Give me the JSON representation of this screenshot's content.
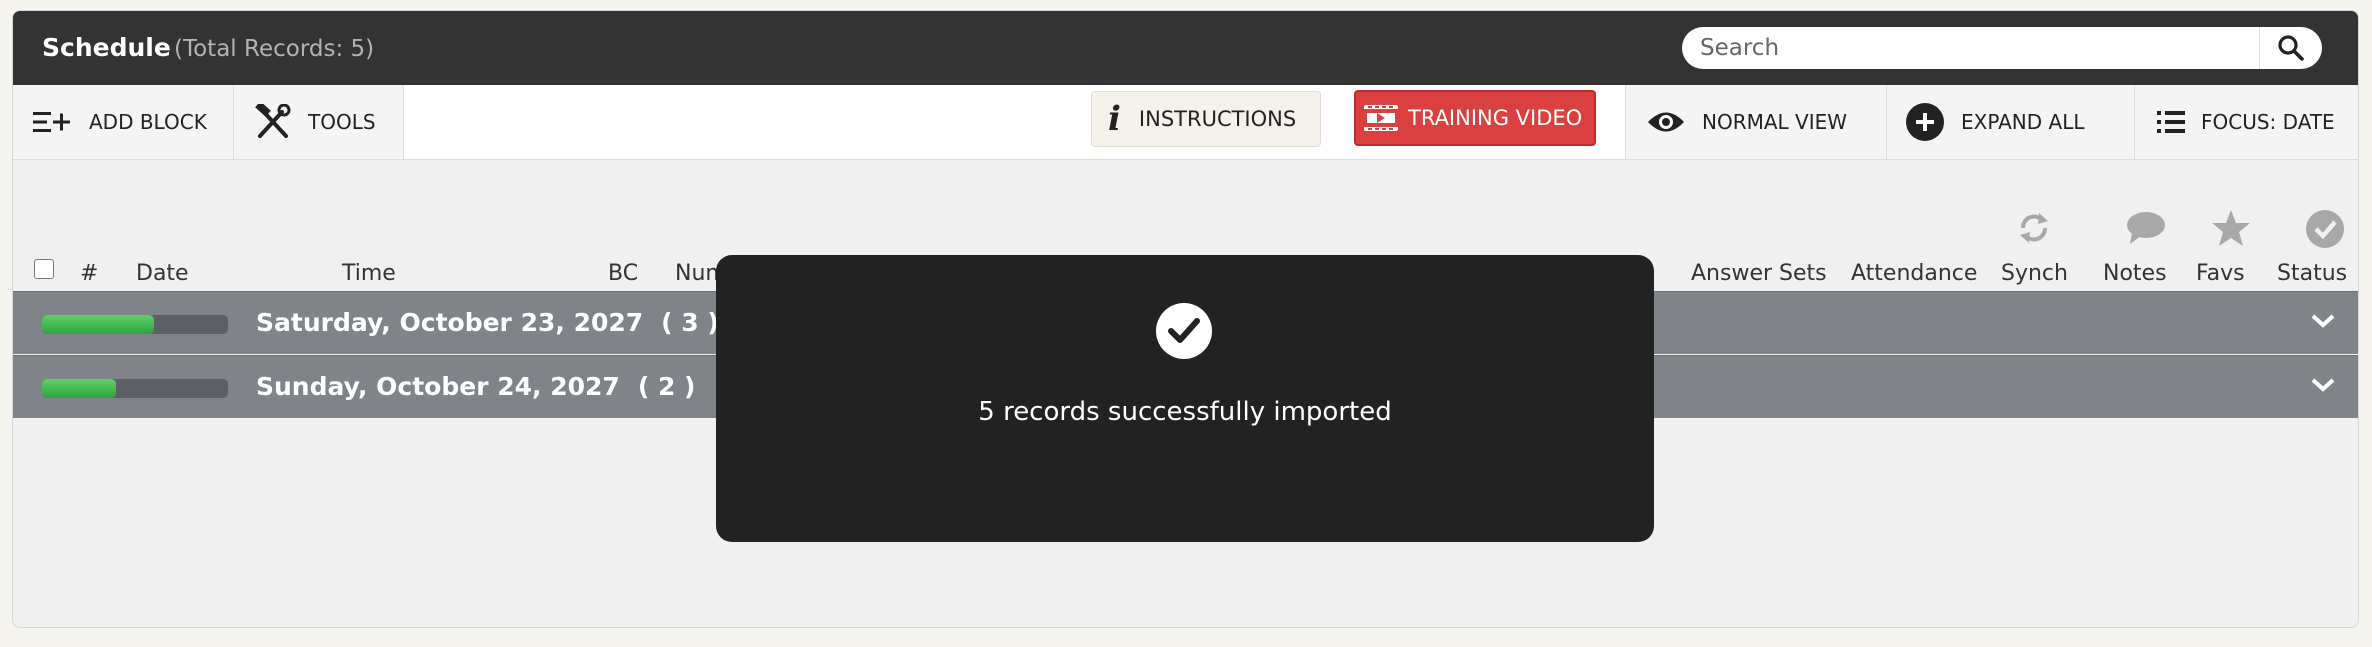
{
  "header": {
    "title": "Schedule",
    "total_records": "(Total Records: 5)",
    "search": {
      "placeholder": "Search",
      "value": ""
    }
  },
  "toolbar": {
    "add_block": "ADD BLOCK",
    "tools": "TOOLS",
    "instructions": "INSTRUCTIONS",
    "training_video": "TRAINING VIDEO",
    "normal_view": "NORMAL VIEW",
    "expand_all": "EXPAND ALL",
    "focus": "FOCUS: DATE"
  },
  "columns": {
    "number": "#",
    "date": "Date",
    "time": "Time",
    "bc": "BC",
    "num": "Num",
    "answer_sets": "Answer Sets",
    "attendance": "Attendance",
    "synch": "Synch",
    "notes": "Notes",
    "favs": "Favs",
    "status": "Status"
  },
  "groups": [
    {
      "date": "Saturday, October 23, 2027",
      "count": "( 3 )",
      "progress": 0.6
    },
    {
      "date": "Sunday, October 24, 2027",
      "count": "( 2 )",
      "progress": 0.4
    }
  ],
  "modal": {
    "message": "5 records successfully imported",
    "icon": "check-circle-icon"
  },
  "colors": {
    "header_bg": "#333333",
    "training_red": "#d9403f",
    "group_bg": "#808489",
    "progress_green": "#3db14b",
    "modal_bg": "#222222"
  }
}
